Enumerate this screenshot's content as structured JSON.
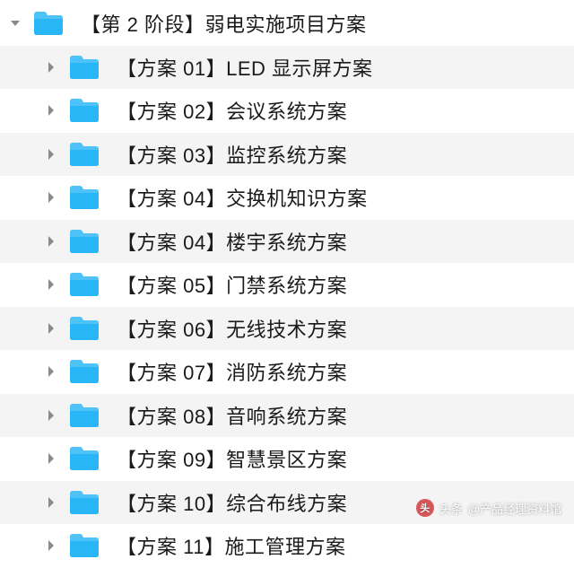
{
  "root": {
    "label": "【第 2 阶段】弱电实施项目方案",
    "expanded": true
  },
  "children": [
    {
      "label": "【方案 01】LED 显示屏方案"
    },
    {
      "label": "【方案 02】会议系统方案"
    },
    {
      "label": "【方案 03】监控系统方案"
    },
    {
      "label": "【方案 04】交换机知识方案"
    },
    {
      "label": "【方案 04】楼宇系统方案"
    },
    {
      "label": "【方案 05】门禁系统方案"
    },
    {
      "label": "【方案 06】无线技术方案"
    },
    {
      "label": "【方案 07】消防系统方案"
    },
    {
      "label": "【方案 08】音响系统方案"
    },
    {
      "label": "【方案 09】智慧景区方案"
    },
    {
      "label": "【方案 10】综合布线方案"
    },
    {
      "label": "【方案 11】施工管理方案"
    }
  ],
  "watermark": {
    "prefix": "头条",
    "handle": "@产品经理资料馆"
  }
}
